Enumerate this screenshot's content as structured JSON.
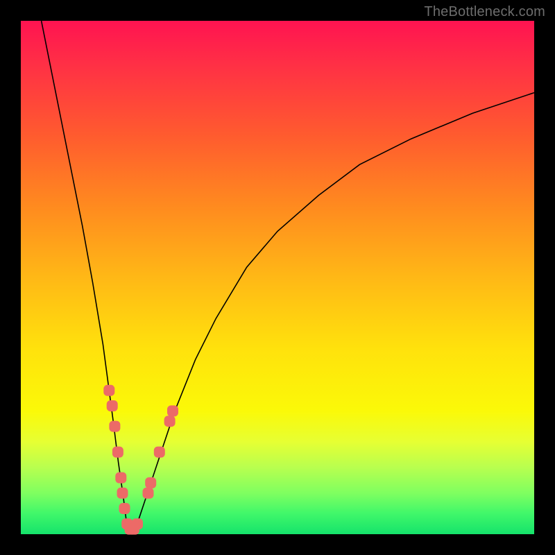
{
  "watermark": "TheBottleneck.com",
  "chart_data": {
    "type": "line",
    "title": "",
    "xlabel": "",
    "ylabel": "",
    "xlim": [
      0,
      100
    ],
    "ylim": [
      0,
      100
    ],
    "grid": false,
    "legend": false,
    "series": [
      {
        "name": "curve",
        "x": [
          4,
          6,
          8,
          10,
          12,
          14,
          16,
          18,
          19,
          20,
          20.5,
          21,
          22,
          23,
          24,
          26,
          28,
          30,
          34,
          38,
          44,
          50,
          58,
          66,
          76,
          88,
          100
        ],
        "y": [
          100,
          90,
          80,
          70,
          60,
          49,
          37,
          22,
          14,
          7,
          3,
          0,
          1,
          3,
          6,
          12,
          18,
          24,
          34,
          42,
          52,
          59,
          66,
          72,
          77,
          82,
          86
        ]
      }
    ],
    "markers": [
      {
        "x": 17.2,
        "y": 28
      },
      {
        "x": 17.8,
        "y": 25
      },
      {
        "x": 18.3,
        "y": 21
      },
      {
        "x": 18.9,
        "y": 16
      },
      {
        "x": 19.5,
        "y": 11
      },
      {
        "x": 19.8,
        "y": 8
      },
      {
        "x": 20.2,
        "y": 5
      },
      {
        "x": 20.7,
        "y": 2
      },
      {
        "x": 21.3,
        "y": 1
      },
      {
        "x": 22.0,
        "y": 1
      },
      {
        "x": 22.7,
        "y": 2
      },
      {
        "x": 24.8,
        "y": 8
      },
      {
        "x": 25.3,
        "y": 10
      },
      {
        "x": 27.0,
        "y": 16
      },
      {
        "x": 29.0,
        "y": 22
      },
      {
        "x": 29.6,
        "y": 24
      }
    ],
    "marker_radius_px": 8
  },
  "colors": {
    "marker": "#ec6a67",
    "curve": "#000000"
  }
}
